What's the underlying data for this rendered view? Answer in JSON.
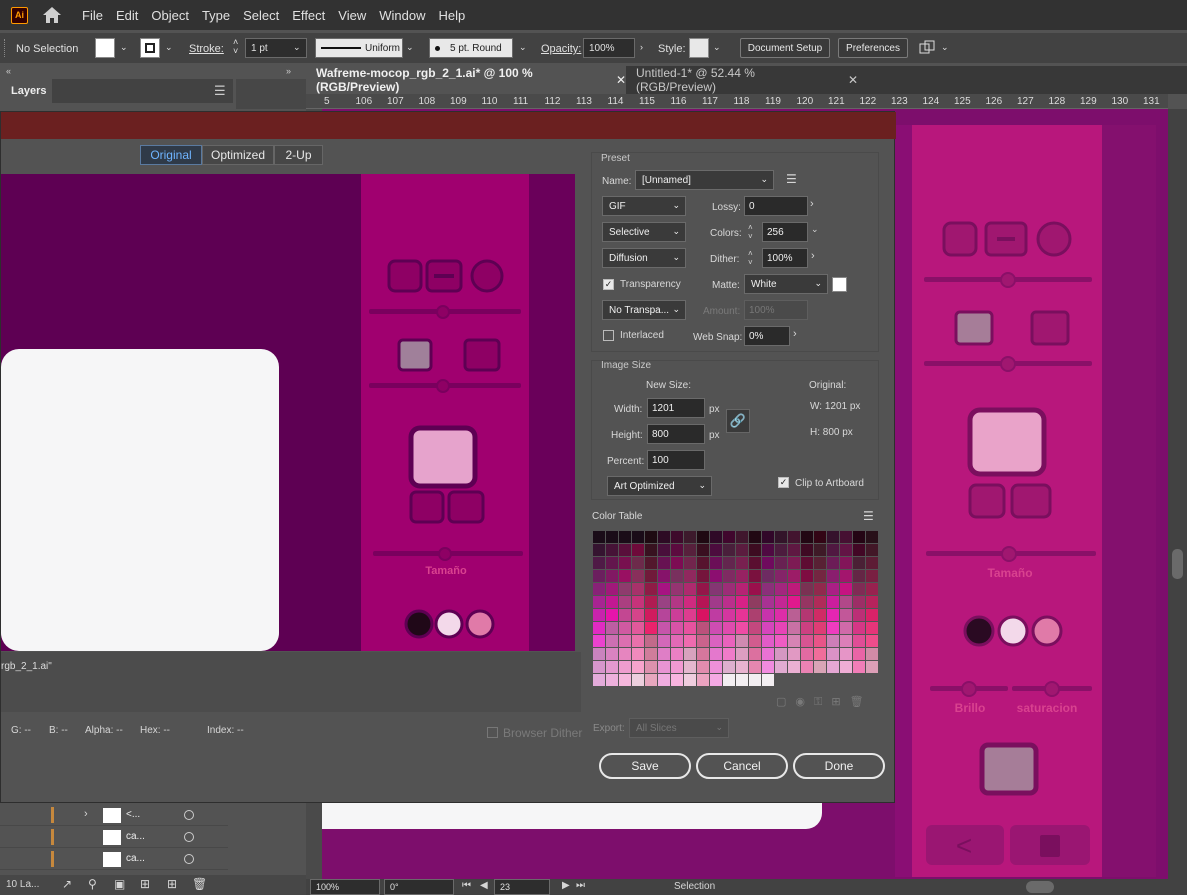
{
  "app": {
    "logo": "Ai"
  },
  "menu": [
    "File",
    "Edit",
    "Object",
    "Type",
    "Select",
    "Effect",
    "View",
    "Window",
    "Help"
  ],
  "control_bar": {
    "selection": "No Selection",
    "stroke_label": "Stroke:",
    "stroke_value": "1 pt",
    "stroke_profile": "Uniform",
    "brush": "5 pt. Round",
    "opacity_label": "Opacity:",
    "opacity_value": "100%",
    "style_label": "Style:",
    "document_setup": "Document Setup",
    "preferences": "Preferences"
  },
  "panels": {
    "layers_title": "Layers",
    "layers_count": "10 La..."
  },
  "tabs": [
    {
      "label": "Wafreme-mocop_rgb_2_1.ai* @ 100 % (RGB/Preview)"
    },
    {
      "label": "Untitled-1* @ 52.44 % (RGB/Preview)"
    }
  ],
  "ruler": [
    "5",
    "106",
    "107",
    "108",
    "109",
    "110",
    "111",
    "112",
    "113",
    "114",
    "115",
    "116",
    "117",
    "118",
    "119",
    "120",
    "121",
    "122",
    "123",
    "124",
    "125",
    "126",
    "127",
    "128",
    "129",
    "130",
    "131"
  ],
  "dialog": {
    "view_tabs": [
      "Original",
      "Optimized",
      "2-Up"
    ],
    "active_view": "Original",
    "file_caption": "rgb_2_1.ai\"",
    "readouts": {
      "g": "G: --",
      "b": "B: --",
      "alpha": "Alpha: --",
      "hex": "Hex: --",
      "index": "Index: --"
    },
    "preset": {
      "section": "Preset",
      "name_label": "Name:",
      "name_value": "[Unnamed]",
      "format": "GIF",
      "lossy_label": "Lossy:",
      "lossy_value": "0",
      "reduction": "Selective",
      "colors_label": "Colors:",
      "colors_value": "256",
      "dither_algo": "Diffusion",
      "dither_label": "Dither:",
      "dither_value": "100%",
      "transparency_label": "Transparency",
      "transparency_checked": true,
      "matte_label": "Matte:",
      "matte_value": "White",
      "trans_dither": "No Transpa...",
      "amount_label": "Amount:",
      "amount_value": "100%",
      "interlaced_label": "Interlaced",
      "interlaced_checked": false,
      "websnap_label": "Web Snap:",
      "websnap_value": "0%"
    },
    "image_size": {
      "section": "Image Size",
      "new_size_label": "New Size:",
      "width_label": "Width:",
      "width_value": "1201",
      "height_label": "Height:",
      "height_value": "800",
      "percent_label": "Percent:",
      "percent_value": "100",
      "px": "px",
      "original_label": "Original:",
      "orig_w": "W:   1201 px",
      "orig_h": "H:   800 px",
      "quality": "Art Optimized",
      "clip_label": "Clip to Artboard",
      "clip_checked": true
    },
    "color_table": {
      "title": "Color Table"
    },
    "export_label": "Export:",
    "export_value": "All Slices",
    "browser_dither": "Browser Dither",
    "buttons": {
      "save": "Save",
      "cancel": "Cancel",
      "done": "Done"
    }
  },
  "preview": {
    "tamano": "Tamaño"
  },
  "canvas": {
    "tamano": "Tamaño",
    "brillo": "Brillo",
    "saturacion": "saturacion"
  },
  "layers": [
    {
      "name": "<..."
    },
    {
      "name": "ca..."
    },
    {
      "name": "ca..."
    }
  ],
  "status": {
    "zoom": "100%",
    "rotate": "0°",
    "artboard": "23",
    "tool": "Selection"
  },
  "colors": {
    "accent": "#ff9a00",
    "dialog_title": "#6b2020",
    "panel_magenta": "#b0197a",
    "dark_purple": "#5a0050"
  }
}
